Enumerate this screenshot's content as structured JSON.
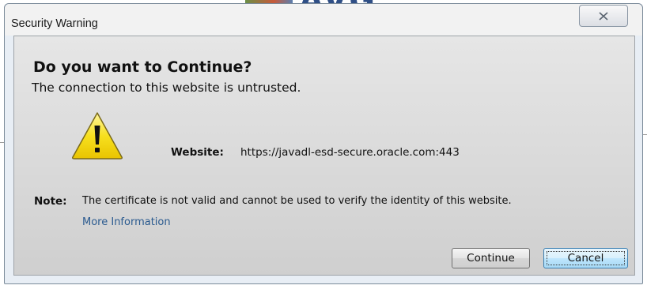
{
  "background": {
    "logo_text": "AVG"
  },
  "dialog": {
    "title": "Security Warning",
    "close_icon": "close-icon",
    "heading": "Do you want to Continue?",
    "subheading": "The connection to this website is untrusted.",
    "warning_icon": "warning-icon",
    "website_label": "Website:",
    "website_value": "https://javadl-esd-secure.oracle.com:443",
    "note_label": "Note:",
    "note_text": "The certificate is not valid and cannot be used to verify the identity of this website.",
    "more_info_link": "More Information",
    "buttons": {
      "continue": "Continue",
      "cancel": "Cancel"
    }
  },
  "colors": {
    "link": "#2a5a8f",
    "warning_fill": "#f7e01f",
    "default_button_border": "#3c7fb1"
  }
}
